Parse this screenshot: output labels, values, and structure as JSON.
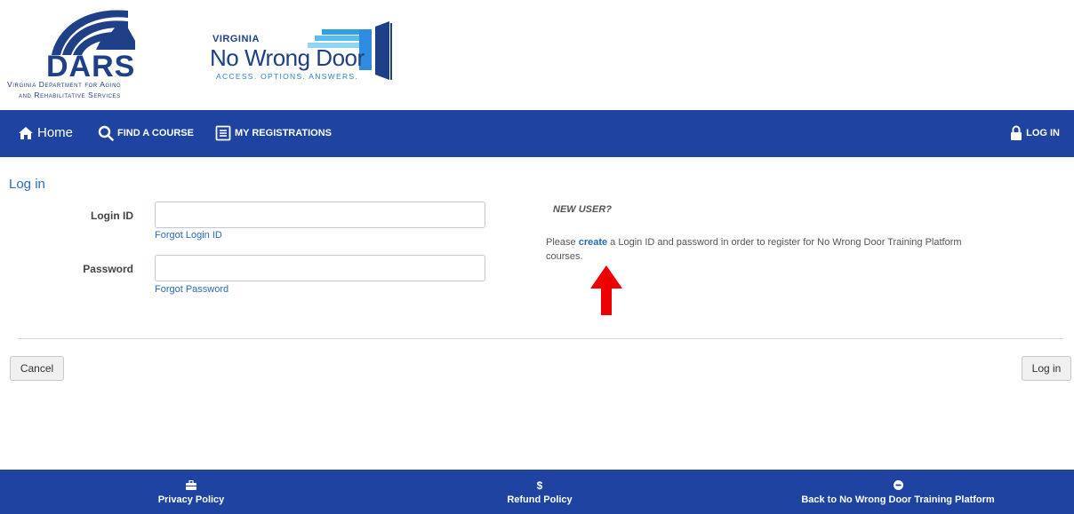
{
  "header": {
    "dars_logo": {
      "name": "DARS",
      "line1": "Virginia Department for Aging",
      "line2": "and Rehabilitative Services"
    },
    "nwd_logo": {
      "state": "VIRGINIA",
      "title": "No Wrong Door",
      "tagline": "ACCESS. OPTIONS. ANSWERS."
    }
  },
  "navbar": {
    "home": "Home",
    "find_course": "FIND A COURSE",
    "my_registrations": "MY REGISTRATIONS",
    "login": "LOG IN"
  },
  "main": {
    "title": "Log in",
    "login_id_label": "Login ID",
    "login_id_value": "",
    "forgot_login_id": "Forgot Login ID",
    "password_label": "Password",
    "password_value": "",
    "forgot_password": "Forgot Password",
    "new_user": {
      "title": "NEW USER?",
      "text_before": "Please ",
      "create_link": "create",
      "text_after": " a Login ID and password in order to register for No Wrong Door Training Platform courses."
    },
    "cancel_button": "Cancel",
    "login_button": "Log in"
  },
  "footer": {
    "privacy": "Privacy Policy",
    "refund": "Refund Policy",
    "refund_icon": "$",
    "back": "Back to No Wrong Door Training Platform"
  },
  "colors": {
    "navbar": "#1e43a1",
    "link": "#2a6ab8",
    "arrow": "#ee0000"
  }
}
